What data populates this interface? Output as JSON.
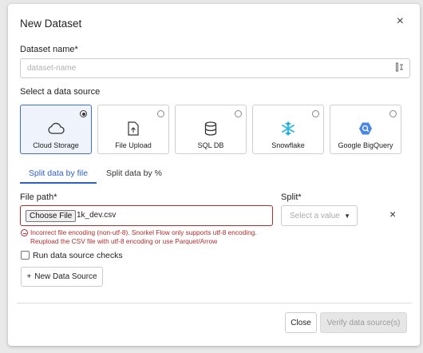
{
  "dialog": {
    "title": "New Dataset",
    "close_glyph": "×"
  },
  "dataset_name": {
    "label": "Dataset name*",
    "placeholder": "dataset-name",
    "value": "",
    "icon": "form-fill-icon"
  },
  "data_source": {
    "label": "Select a data source",
    "selected": "Cloud Storage",
    "options": [
      {
        "label": "Cloud Storage",
        "icon": "cloud-icon",
        "selected": true
      },
      {
        "label": "File Upload",
        "icon": "file-upload-icon",
        "selected": false
      },
      {
        "label": "SQL DB",
        "icon": "database-icon",
        "selected": false
      },
      {
        "label": "Snowflake",
        "icon": "snowflake-icon",
        "selected": false
      },
      {
        "label": "Google BigQuery",
        "icon": "bigquery-icon",
        "selected": false
      }
    ]
  },
  "tabs": [
    {
      "label": "Split data by file",
      "active": true
    },
    {
      "label": "Split data by %",
      "active": false
    }
  ],
  "file_row": {
    "file_label": "File path*",
    "choose_button": "Choose File",
    "file_name": "1k_dev.csv",
    "split_label": "Split*",
    "split_placeholder": "Select a value",
    "remove_glyph": "×",
    "error_line1": "Incorrect file encoding (non-utf-8). Snorkel Flow only supports utf-8 encoding.",
    "error_line2": "Reupload the CSV file with utf-8 encoding or use Parquet/Arrow"
  },
  "checks": {
    "label": "Run data source checks",
    "checked": false
  },
  "add_source_button": "New Data Source",
  "footer": {
    "close_label": "Close",
    "verify_label": "Verify data source(s)"
  },
  "colors": {
    "accent": "#2e5fc7",
    "error": "#b42b2b",
    "selected_bg": "#eef3fc",
    "bigquery": "#4a86e8",
    "snowflake": "#29b5e8"
  }
}
